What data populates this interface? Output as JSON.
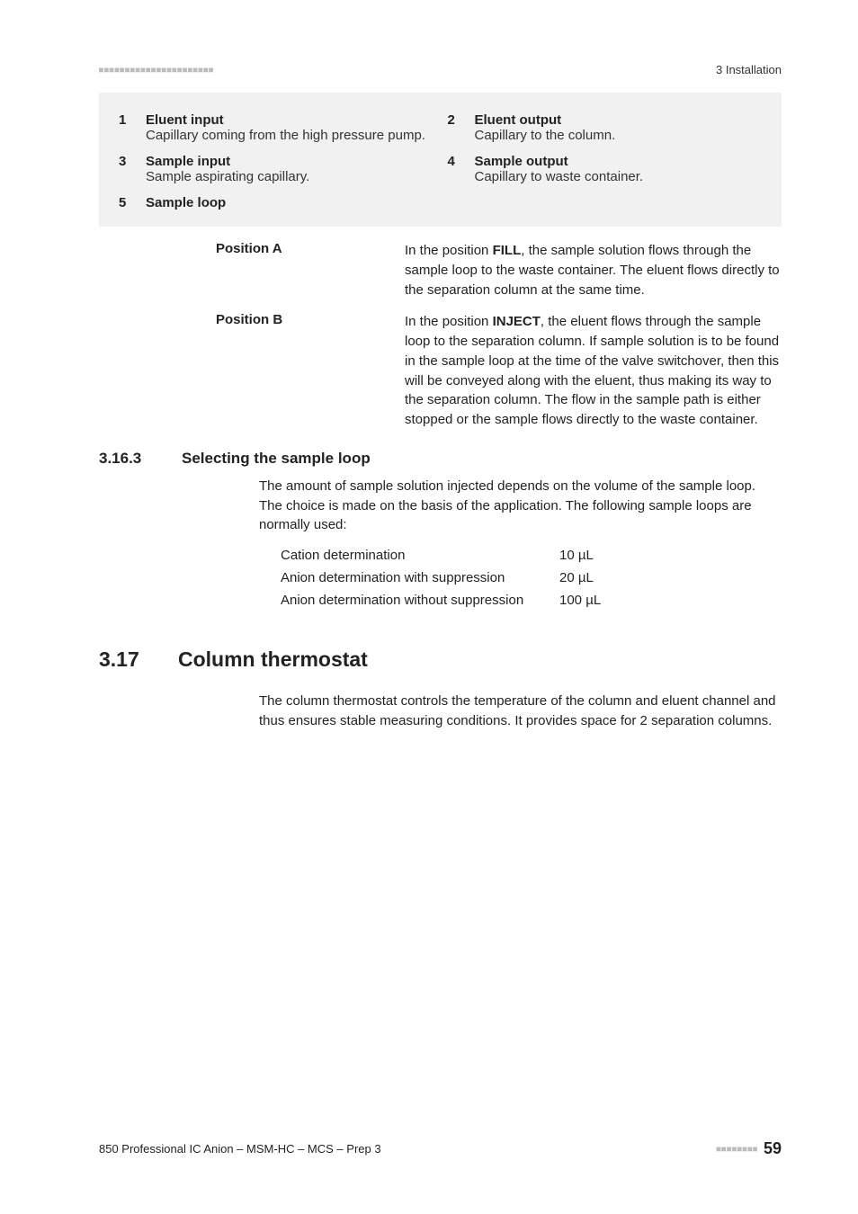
{
  "header": {
    "chapter": "3 Installation"
  },
  "definitions": {
    "r1": {
      "left": {
        "num": "1",
        "title": "Eluent input",
        "desc": "Capillary coming from the high pressure pump."
      },
      "right": {
        "num": "2",
        "title": "Eluent output",
        "desc": "Capillary to the column."
      }
    },
    "r2": {
      "left": {
        "num": "3",
        "title": "Sample input",
        "desc": "Sample aspirating capillary."
      },
      "right": {
        "num": "4",
        "title": "Sample output",
        "desc": "Capillary to waste container."
      }
    },
    "r3": {
      "left": {
        "num": "5",
        "title": "Sample loop",
        "desc": ""
      }
    }
  },
  "positions": {
    "a": {
      "label": "Position A",
      "pre": "In the position ",
      "bold": "FILL",
      "post": ", the sample solution flows through the sample loop to the waste container. The eluent flows directly to the separation column at the same time."
    },
    "b": {
      "label": "Position B",
      "pre": "In the position ",
      "bold": "INJECT",
      "post": ", the eluent flows through the sample loop to the separation column. If sample solution is to be found in the sample loop at the time of the valve switchover, then this will be conveyed along with the eluent, thus making its way to the separation column. The flow in the sample path is either stopped or the sample flows directly to the waste container."
    }
  },
  "sec3163": {
    "num": "3.16.3",
    "title": "Selecting the sample loop",
    "para": "The amount of sample solution injected depends on the volume of the sample loop. The choice is made on the basis of the application. The following sample loops are normally used:",
    "rows": {
      "r1": {
        "label": "Cation determination",
        "val": "10 µL"
      },
      "r2": {
        "label": "Anion determination with suppression",
        "val": "20 µL"
      },
      "r3": {
        "label": "Anion determination without suppression",
        "val": "100 µL"
      }
    }
  },
  "sec317": {
    "num": "3.17",
    "title": "Column thermostat",
    "para": "The column thermostat controls the temperature of the column and eluent channel and thus ensures stable measuring conditions. It provides space for 2 separation columns."
  },
  "footer": {
    "doc": "850 Professional IC Anion – MSM-HC – MCS – Prep 3",
    "page": "59"
  }
}
